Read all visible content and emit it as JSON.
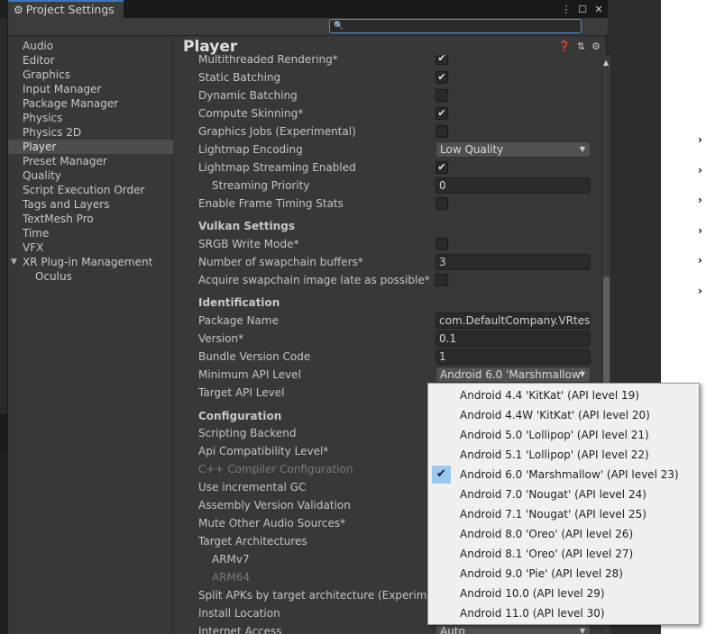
{
  "window": {
    "tab_title": "Project Settings",
    "search_placeholder": ""
  },
  "sidebar": {
    "items": [
      {
        "label": "Audio"
      },
      {
        "label": "Editor"
      },
      {
        "label": "Graphics"
      },
      {
        "label": "Input Manager"
      },
      {
        "label": "Package Manager"
      },
      {
        "label": "Physics"
      },
      {
        "label": "Physics 2D"
      },
      {
        "label": "Player",
        "selected": true
      },
      {
        "label": "Preset Manager"
      },
      {
        "label": "Quality"
      },
      {
        "label": "Script Execution Order"
      },
      {
        "label": "Tags and Layers"
      },
      {
        "label": "TextMesh Pro"
      },
      {
        "label": "Time"
      },
      {
        "label": "VFX"
      },
      {
        "label": "XR Plug-in Management",
        "expanded": true
      },
      {
        "label": "Oculus",
        "child": true
      }
    ]
  },
  "main": {
    "title": "Player",
    "rendering": {
      "multithreaded": "Multithreaded Rendering*",
      "static_batching": "Static Batching",
      "dynamic_batching": "Dynamic Batching",
      "compute_skinning": "Compute Skinning*",
      "graphics_jobs": "Graphics Jobs (Experimental)",
      "lightmap_encoding": "Lightmap Encoding",
      "lightmap_encoding_value": "Low Quality",
      "lightmap_streaming": "Lightmap Streaming Enabled",
      "streaming_priority": "Streaming Priority",
      "streaming_priority_value": "0",
      "frame_timing": "Enable Frame Timing Stats"
    },
    "vulkan": {
      "header": "Vulkan Settings",
      "srgb": "SRGB Write Mode*",
      "swapchain": "Number of swapchain buffers*",
      "swapchain_value": "3",
      "acquire": "Acquire swapchain image late as possible*"
    },
    "identification": {
      "header": "Identification",
      "package_name": "Package Name",
      "package_name_value": "com.DefaultCompany.VRtest",
      "version": "Version*",
      "version_value": "0.1",
      "bundle_code": "Bundle Version Code",
      "bundle_code_value": "1",
      "min_api": "Minimum API Level",
      "min_api_value": "Android 6.0 'Marshmallow'",
      "target_api": "Target API Level"
    },
    "configuration": {
      "header": "Configuration",
      "scripting_backend": "Scripting Backend",
      "api_compat": "Api Compatibility Level*",
      "cpp_config": "C++ Compiler Configuration",
      "incremental_gc": "Use incremental GC",
      "assembly_validation": "Assembly Version Validation",
      "mute_audio": "Mute Other Audio Sources*",
      "target_arch": "Target Architectures",
      "armv7": "ARMv7",
      "arm64": "ARM64",
      "split_apks": "Split APKs by target architecture (Experimental)",
      "install_location": "Install Location",
      "internet_access": "Internet Access",
      "internet_access_value": "Auto"
    }
  },
  "api_popup": {
    "options": [
      "Android 4.4 'KitKat' (API level 19)",
      "Android 4.4W 'KitKat' (API level 20)",
      "Android 5.0 'Lollipop' (API level 21)",
      "Android 5.1 'Lollipop' (API level 22)",
      "Android 6.0 'Marshmallow' (API level 23)",
      "Android 7.0 'Nougat' (API level 24)",
      "Android 7.1 'Nougat' (API level 25)",
      "Android 8.0 'Oreo' (API level 26)",
      "Android 8.1 'Oreo' (API level 27)",
      "Android 9.0 'Pie' (API level 28)",
      "Android 10.0 (API level 29)",
      "Android 11.0 (API level 30)"
    ],
    "selected_index": 4
  },
  "colors": {
    "panel": "#383838",
    "selection": "#4d4d4d",
    "popup_check": "#99c9ef",
    "accent": "#3a79bb"
  }
}
